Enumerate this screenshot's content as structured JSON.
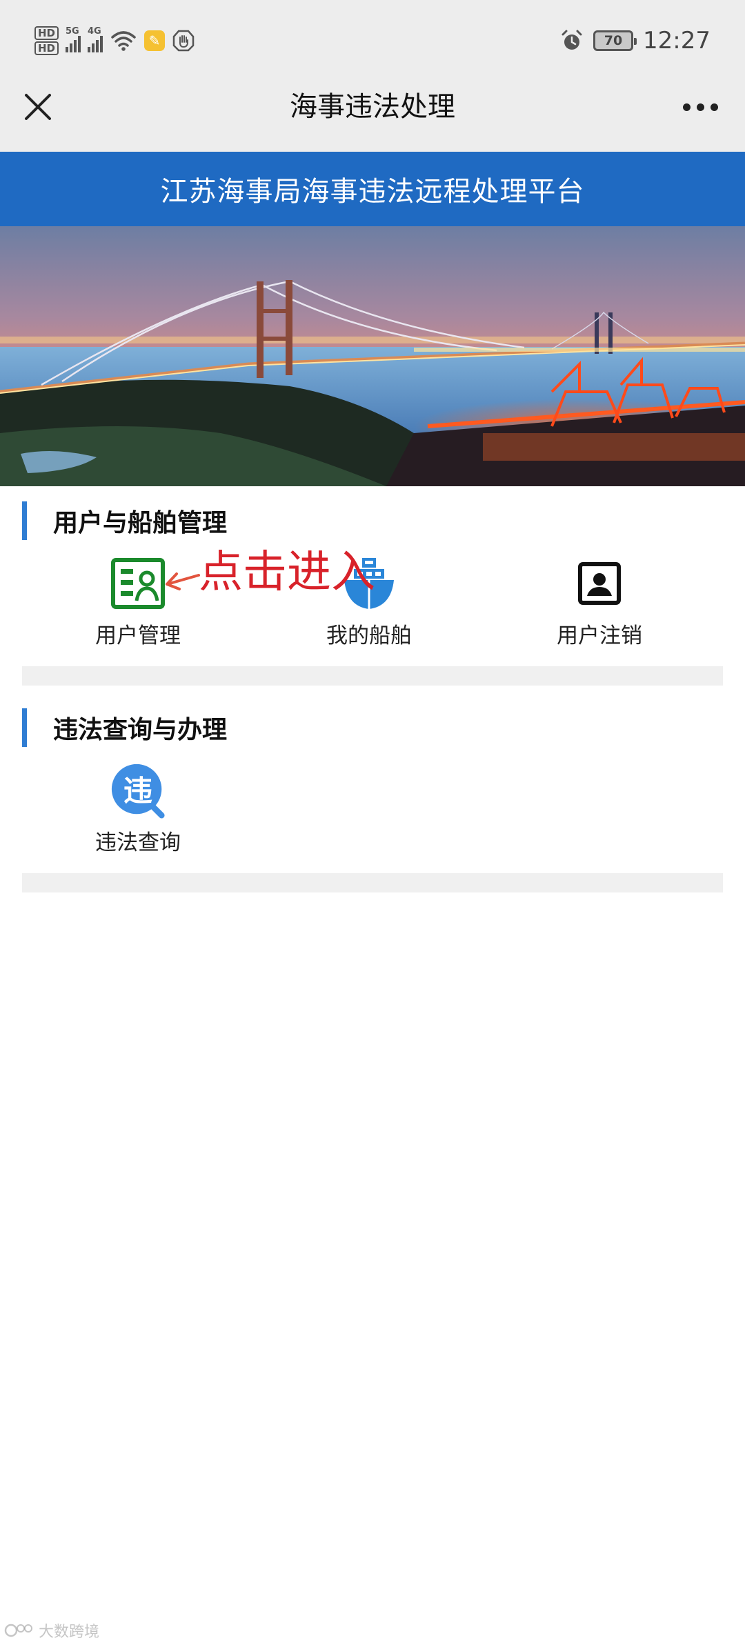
{
  "status_bar": {
    "hd1": "HD",
    "hd2": "HD",
    "signal1_label": "5G",
    "signal2_label": "4G",
    "battery": "70",
    "time": "12:27"
  },
  "titlebar": {
    "title": "海事违法处理"
  },
  "platform_title": "江苏海事局海事违法远程处理平台",
  "sections": [
    {
      "title": "用户与船舶管理",
      "items": [
        {
          "label": "用户管理",
          "icon": "user-management-icon",
          "color": "#1b8a2c"
        },
        {
          "label": "我的船舶",
          "icon": "ship-icon",
          "color": "#2a86d8"
        },
        {
          "label": "用户注销",
          "icon": "user-deregister-icon",
          "color": "#111111"
        }
      ]
    },
    {
      "title": "违法查询与办理",
      "items": [
        {
          "label": "违法查询",
          "icon": "violation-query-icon",
          "icon_text": "违",
          "color": "#3f8ee3"
        }
      ]
    }
  ],
  "annotation": {
    "text": "点击进入",
    "color": "#d8222a"
  },
  "watermark": "大数跨境",
  "colors": {
    "header_blue": "#1f6ac2",
    "section_bar": "#2f7dd3",
    "nav_bg": "#ededed"
  }
}
